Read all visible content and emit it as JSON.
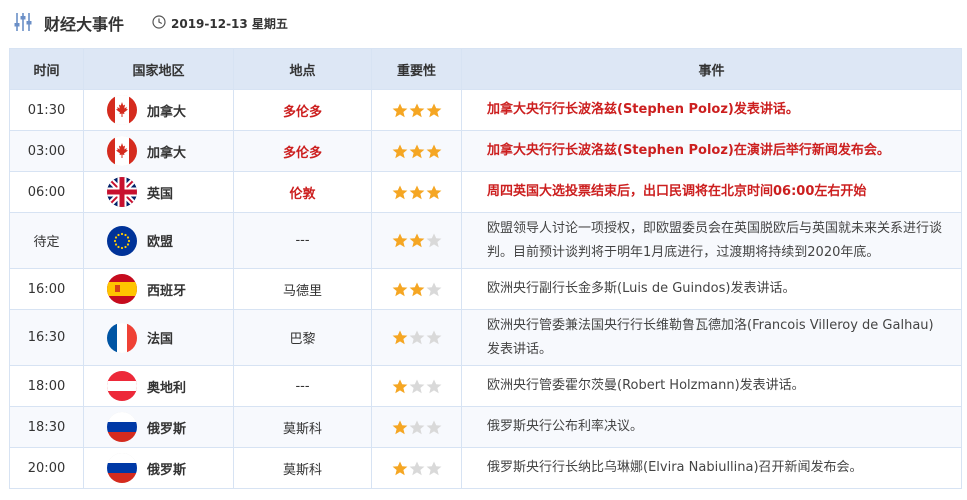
{
  "header": {
    "title": "财经大事件",
    "date": "2019-12-13 星期五"
  },
  "columns": {
    "time": "时间",
    "country": "国家地区",
    "place": "地点",
    "importance": "重要性",
    "event": "事件"
  },
  "colors": {
    "header_bg": "#dde7f5",
    "highlight_red": "#cc1f1f",
    "star_on": "#f5a623",
    "star_off": "#d9d9d9"
  },
  "rows": [
    {
      "time": "01:30",
      "flag": "canada-flag-icon",
      "country": "加拿大",
      "place": "多伦多",
      "stars": 3,
      "highlight": true,
      "event": "加拿大央行行长波洛兹(Stephen Poloz)发表讲话。"
    },
    {
      "time": "03:00",
      "flag": "canada-flag-icon",
      "country": "加拿大",
      "place": "多伦多",
      "stars": 3,
      "highlight": true,
      "event": "加拿大央行行长波洛兹(Stephen Poloz)在演讲后举行新闻发布会。"
    },
    {
      "time": "06:00",
      "flag": "uk-flag-icon",
      "country": "英国",
      "place": "伦敦",
      "stars": 3,
      "highlight": true,
      "event": "周四英国大选投票结束后，出口民调将在北京时间06:00左右开始"
    },
    {
      "time": "待定",
      "flag": "eu-flag-icon",
      "country": "欧盟",
      "place": "---",
      "stars": 2,
      "highlight": false,
      "event": "欧盟领导人讨论一项授权，即欧盟委员会在英国脱欧后与英国就未来关系进行谈判。目前预计谈判将于明年1月底进行，过渡期将持续到2020年底。"
    },
    {
      "time": "16:00",
      "flag": "spain-flag-icon",
      "country": "西班牙",
      "place": "马德里",
      "stars": 2,
      "highlight": false,
      "event": "欧洲央行副行长金多斯(Luis de Guindos)发表讲话。"
    },
    {
      "time": "16:30",
      "flag": "france-flag-icon",
      "country": "法国",
      "place": "巴黎",
      "stars": 1,
      "highlight": false,
      "event": "欧洲央行管委兼法国央行行长维勒鲁瓦德加洛(Francois Villeroy de Galhau)发表讲话。"
    },
    {
      "time": "18:00",
      "flag": "austria-flag-icon",
      "country": "奥地利",
      "place": "---",
      "stars": 1,
      "highlight": false,
      "event": "欧洲央行管委霍尔茨曼(Robert Holzmann)发表讲话。"
    },
    {
      "time": "18:30",
      "flag": "russia-flag-icon",
      "country": "俄罗斯",
      "place": "莫斯科",
      "stars": 1,
      "highlight": false,
      "event": "俄罗斯央行公布利率决议。"
    },
    {
      "time": "20:00",
      "flag": "russia-flag-icon",
      "country": "俄罗斯",
      "place": "莫斯科",
      "stars": 1,
      "highlight": false,
      "event": "俄罗斯央行行长纳比乌琳娜(Elvira Nabiullina)召开新闻发布会。"
    }
  ]
}
